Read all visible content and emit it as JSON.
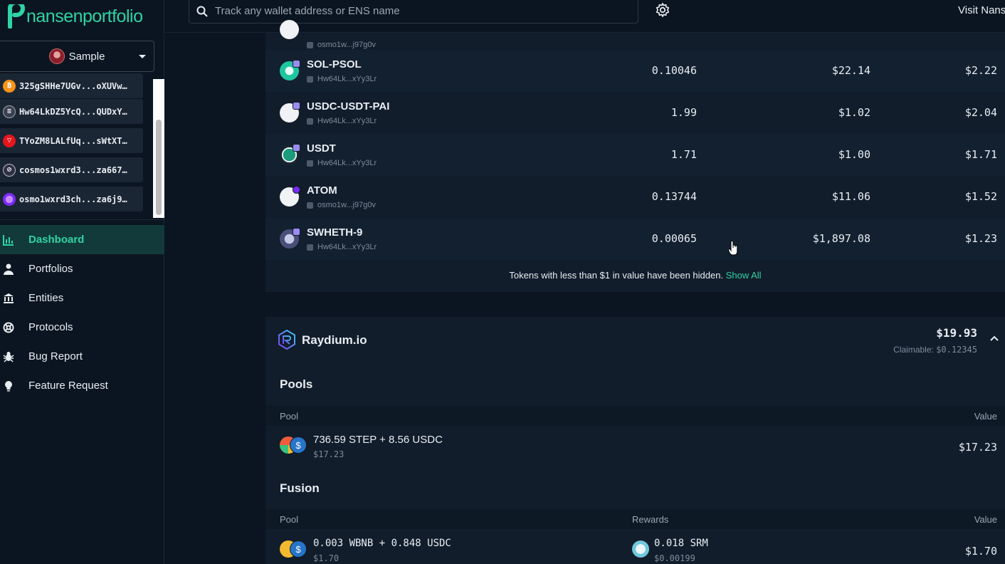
{
  "app": {
    "logo_part1": "nansen",
    "logo_part2": "portfolio"
  },
  "sidebar": {
    "selected_portfolio": "Sample",
    "wallets": [
      {
        "address": "325gSHHe7UGv...oXUVw…",
        "chain_icon": "bitcoin-icon",
        "color": "#f7931a"
      },
      {
        "address": "Hw64LkDZ5YcQ...QUDxY…",
        "chain_icon": "solana-icon",
        "color": "#3b3f52"
      },
      {
        "address": "TYoZM8LALfUq...sWtXT…",
        "chain_icon": "tron-icon",
        "color": "#e5161d"
      },
      {
        "address": "cosmos1wxrd3...za667…",
        "chain_icon": "cosmos-icon",
        "color": "#2e3148"
      },
      {
        "address": "osmo1wxrd3ch...za6j9…",
        "chain_icon": "osmosis-icon",
        "color": "#7b2bf9"
      }
    ],
    "nav": [
      {
        "label": "Dashboard",
        "icon": "chart-icon",
        "active": true
      },
      {
        "label": "Portfolios",
        "icon": "user-icon",
        "active": false
      },
      {
        "label": "Entities",
        "icon": "bank-icon",
        "active": false
      },
      {
        "label": "Protocols",
        "icon": "lifebuoy-icon",
        "active": false
      },
      {
        "label": "Bug Report",
        "icon": "bug-icon",
        "active": false
      },
      {
        "label": "Feature Request",
        "icon": "lightbulb-icon",
        "active": false
      }
    ]
  },
  "topbar": {
    "search_placeholder": "Track any wallet address or ENS name",
    "visit_text": "Visit Nans"
  },
  "tokens": {
    "partial_row_addr": "osmo1w...j97g0v",
    "rows": [
      {
        "name": "SOL-PSOL",
        "addr": "Hw64Lk...xYy3Lr",
        "amount": "0.10046",
        "price": "$22.14",
        "value": "$2.22",
        "color": "#1fc7a0"
      },
      {
        "name": "USDC-USDT-PAI",
        "addr": "Hw64Lk...xYy3Lr",
        "amount": "1.99",
        "price": "$1.02",
        "value": "$2.04",
        "color": "#f0f2f5"
      },
      {
        "name": "USDT",
        "addr": "Hw64Lk...xYy3Lr",
        "amount": "1.71",
        "price": "$1.00",
        "value": "$1.71",
        "color": "#1b9c7c"
      },
      {
        "name": "ATOM",
        "addr": "osmo1w...j97g0v",
        "amount": "0.13744",
        "price": "$11.06",
        "value": "$1.52",
        "color": "#f0f2f5"
      },
      {
        "name": "SWHETH-9",
        "addr": "Hw64Lk...xYy3Lr",
        "amount": "0.00065",
        "price": "$1,897.08",
        "value": "$1.23",
        "color": "#4a4f7a"
      }
    ],
    "hidden_note": "Tokens with less than $1 in value have been hidden.",
    "show_all": "Show All"
  },
  "raydium": {
    "name": "Raydium.io",
    "total": "$19.93",
    "claimable_label": "Claimable:",
    "claimable_value": "$0.12345",
    "pools_title": "Pools",
    "pools_header": {
      "pool": "Pool",
      "value": "Value"
    },
    "pools": [
      {
        "title": "736.59 STEP + 8.56 USDC",
        "sub": "$17.23",
        "value": "$17.23",
        "icon_a": "step-icon",
        "icon_b": "usdc-icon"
      }
    ],
    "fusion_title": "Fusion",
    "fusion_header": {
      "pool": "Pool",
      "rewards": "Rewards",
      "value": "Value"
    },
    "fusion": [
      {
        "title": "0.003 WBNB + 0.848 USDC",
        "sub": "$1.70",
        "reward": "0.018 SRM",
        "reward_sub": "$0.00199",
        "value": "$1.70",
        "icon_a": "bnb-icon",
        "icon_b": "usdc-icon",
        "reward_icon": "srm-icon"
      }
    ]
  }
}
